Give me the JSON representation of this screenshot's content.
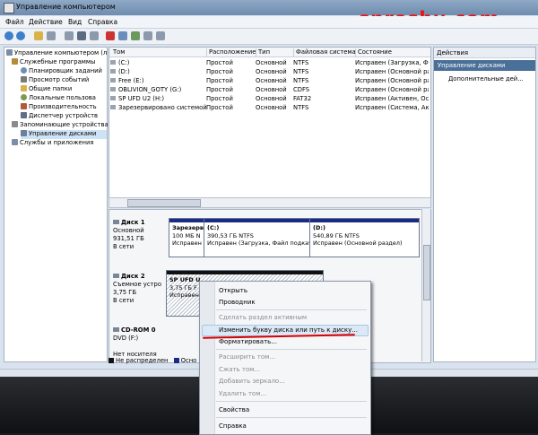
{
  "watermark": "sproshu.com",
  "window": {
    "title": "Управление компьютером"
  },
  "menu": [
    "Файл",
    "Действие",
    "Вид",
    "Справка"
  ],
  "tree": {
    "items": [
      "Управление компьютером (л",
      "Служебные программы",
      "Планировщик заданий",
      "Просмотр событий",
      "Общие папки",
      "Локальные пользова",
      "Производительность",
      "Диспетчер устройств",
      "Запоминающие устройства",
      "Управление дисками",
      "Службы и приложения"
    ]
  },
  "volumes": {
    "headers": [
      "Том",
      "Расположение",
      "Тип",
      "Файловая система",
      "Состояние"
    ],
    "rows": [
      [
        "(C:)",
        "Простой",
        "Основной",
        "NTFS",
        "Исправен (Загрузка, Файл под"
      ],
      [
        "(D:)",
        "Простой",
        "Основной",
        "NTFS",
        "Исправен (Основной раздел"
      ],
      [
        "Free (E:)",
        "Простой",
        "Основной",
        "NTFS",
        "Исправен (Основной раздел"
      ],
      [
        "OBLIVION_GOTY (G:)",
        "Простой",
        "Основной",
        "CDFS",
        "Исправен (Основной раздел"
      ],
      [
        "SP UFD U2 (H:)",
        "Простой",
        "Основной",
        "FAT32",
        "Исправен (Активен, Основн"
      ],
      [
        "Зарезервировано системой",
        "Простой",
        "Основной",
        "NTFS",
        "Исправен (Система, Актив"
      ]
    ]
  },
  "disks": [
    {
      "name": "Диск 1",
      "type": "Основной",
      "size": "931,51 ГБ",
      "status": "В сети"
    },
    {
      "name": "Диск 2",
      "type": "Съемное устро",
      "size": "3,75 ГБ",
      "status": "В сети"
    },
    {
      "name": "CD-ROM 0",
      "type": "DVD (F:)",
      "size": "",
      "status": "Нет носителя"
    }
  ],
  "partitions": {
    "d1p1": {
      "title": "Зарезерв",
      "l1": "100 МБ N",
      "l2": "Исправен"
    },
    "d1p2": {
      "title": "(C:)",
      "l1": "390,53 ГБ NTFS",
      "l2": "Исправен (Загрузка, Файл подкач"
    },
    "d1p3": {
      "title": "(D:)",
      "l1": "540,89 ГБ NTFS",
      "l2": "Исправен (Основной раздел)"
    },
    "d2p1": {
      "title": "SP UFD U",
      "l1": "3,75 ГБ F",
      "l2": "Исправен"
    }
  },
  "legend": [
    "Не распределен",
    "Осно"
  ],
  "actions": {
    "header": "Действия",
    "section": "Управление дисками",
    "item": "Дополнительные дей..."
  },
  "context_menu": [
    {
      "label": "Открыть",
      "disabled": false
    },
    {
      "label": "Проводник",
      "disabled": false
    },
    {
      "label": "Сделать раздел активным",
      "disabled": true
    },
    {
      "label": "Изменить букву диска или путь к диску...",
      "disabled": false
    },
    {
      "label": "Форматировать...",
      "disabled": false
    },
    {
      "label": "Расширить том...",
      "disabled": true
    },
    {
      "label": "Сжать том...",
      "disabled": true
    },
    {
      "label": "Добавить зеркало...",
      "disabled": true
    },
    {
      "label": "Удалить том...",
      "disabled": true
    },
    {
      "label": "Свойства",
      "disabled": false
    },
    {
      "label": "Справка",
      "disabled": false
    }
  ],
  "colors": {
    "primary_partition": "#1b2a86",
    "unallocated": "#111111",
    "highlight_underline": "#d80000"
  }
}
